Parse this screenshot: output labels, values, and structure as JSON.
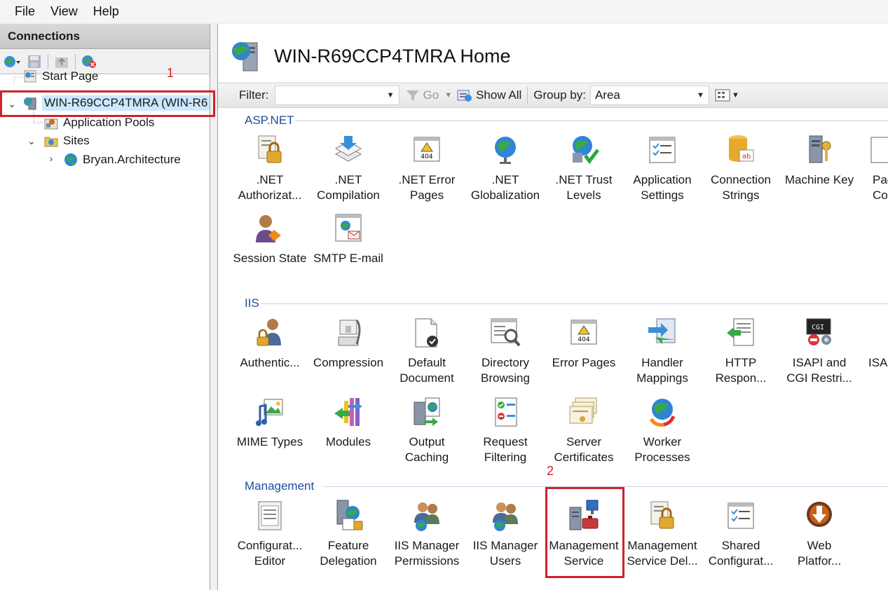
{
  "menu": [
    "File",
    "View",
    "Help"
  ],
  "connections": {
    "header": "Connections",
    "tree": [
      {
        "label": "Start Page"
      },
      {
        "label": "WIN-R69CCP4TMRA (WIN-R6"
      },
      {
        "label": "Application Pools"
      },
      {
        "label": "Sites"
      },
      {
        "label": "Bryan.Architecture"
      }
    ]
  },
  "main": {
    "title": "WIN-R69CCP4TMRA Home",
    "filter": {
      "label": "Filter:",
      "go": "Go",
      "show_all": "Show All",
      "group_by_label": "Group by:",
      "group_by_value": "Area"
    },
    "sections": [
      {
        "name": "ASP.NET",
        "items": [
          ".NET\nAuthorizat...",
          ".NET\nCompilation",
          ".NET Error\nPages",
          ".NET\nGlobalization",
          ".NET Trust\nLevels",
          "Application\nSettings",
          "Connection\nStrings",
          "Machine Key",
          "Pag\nCo",
          "Session State",
          "SMTP E-mail"
        ]
      },
      {
        "name": "IIS",
        "items": [
          "Authentic...",
          "Compression",
          "Default\nDocument",
          "Directory\nBrowsing",
          "Error Pages",
          "Handler\nMappings",
          "HTTP\nRespon...",
          "ISAPI and\nCGI Restri...",
          "ISAP",
          "MIME Types",
          "Modules",
          "Output\nCaching",
          "Request\nFiltering",
          "Server\nCertificates",
          "Worker\nProcesses"
        ]
      },
      {
        "name": "Management",
        "items": [
          "Configurat...\nEditor",
          "Feature\nDelegation",
          "IIS Manager\nPermissions",
          "IIS Manager\nUsers",
          "Management\nService",
          "Management\nService Del...",
          "Shared\nConfigurat...",
          "Web\nPlatfor..."
        ]
      }
    ]
  },
  "annotations": [
    "1",
    "2"
  ],
  "colors": {
    "annotation": "#d0202c",
    "section_header": "#1d4e9e",
    "selection": "#cce8ff"
  }
}
